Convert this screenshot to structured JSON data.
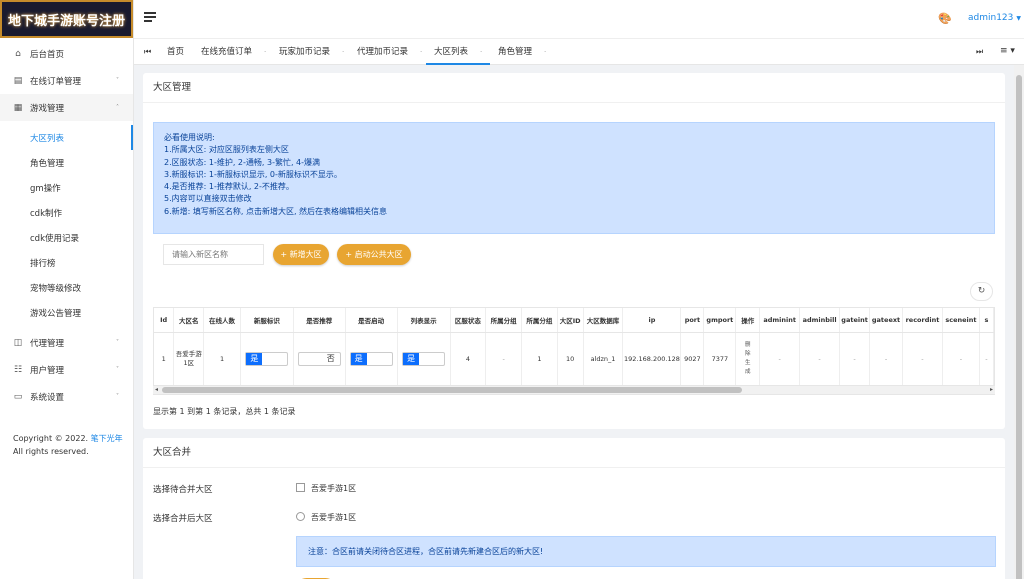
{
  "logo_text": "地下城手游账号注册",
  "sidebar": {
    "items": [
      {
        "label": "后台首页",
        "icon": "dashboard-icon",
        "glyph": "⌂"
      },
      {
        "label": "在线订单管理",
        "icon": "orders-icon",
        "glyph": "▤",
        "chevron": "˅"
      },
      {
        "label": "游戏管理",
        "icon": "game-icon",
        "glyph": "▦",
        "chevron": "˄"
      }
    ],
    "submenu": [
      {
        "label": "大区列表"
      },
      {
        "label": "角色管理"
      },
      {
        "label": "gm操作"
      },
      {
        "label": "cdk制作"
      },
      {
        "label": "cdk使用记录"
      },
      {
        "label": "排行榜"
      },
      {
        "label": "宠物等级修改"
      },
      {
        "label": "游戏公告管理"
      }
    ],
    "items_after": [
      {
        "label": "代理管理",
        "icon": "agent-icon",
        "glyph": "◫",
        "chevron": "˅"
      },
      {
        "label": "用户管理",
        "icon": "users-icon",
        "glyph": "☷",
        "chevron": "˅"
      },
      {
        "label": "系统设置",
        "icon": "settings-icon",
        "glyph": "▭",
        "chevron": "˅"
      }
    ],
    "copyright_prefix": "Copyright © 2022.",
    "copyright_link": "笔下光年",
    "copyright_suffix": "All rights reserved."
  },
  "header": {
    "palette_glyph": "🎨",
    "user": "admin123",
    "user_caret": "▼"
  },
  "tabs": {
    "nav_left": "⏮",
    "nav_right": "⏭",
    "menu": "≡ ▾",
    "close": "·",
    "items": [
      {
        "label": "首页"
      },
      {
        "label": "在线充值订单"
      },
      {
        "label": "玩家加币记录"
      },
      {
        "label": "代理加币记录"
      },
      {
        "label": "大区列表"
      },
      {
        "label": "角色管理"
      }
    ]
  },
  "region_card": {
    "title": "大区管理",
    "notice_lines": [
      "必看使用说明:",
      "1.所属大区: 对应区服列表左侧大区",
      "2.区服状态: 1-维护, 2-通畅, 3-繁忙, 4-爆满",
      "3.新服标识: 1-新服标识显示, 0-新服标识不显示。",
      "4.是否推荐: 1-推荐默认, 2-不推荐。",
      "5.内容可以直接双击修改",
      "6.新增: 填写新区名称, 点击新增大区, 然后在表格编辑相关信息"
    ],
    "input_placeholder": "请输入新区名称",
    "add_button": "+ 新增大区",
    "public_button": "+ 启动公共大区",
    "refresh_glyph": "↻",
    "columns": [
      "Id",
      "大区名",
      "在线人数",
      "新服标识",
      "是否推荐",
      "是否启动",
      "列表显示",
      "区服状态",
      "所属分组",
      "所属分组",
      "大区ID",
      "大区数据库",
      "ip",
      "port",
      "gmport",
      "操作",
      "adminint",
      "adminbill",
      "gateint",
      "gateext",
      "recordint",
      "sceneint",
      "s"
    ],
    "row": {
      "id": "1",
      "name": "吾爱手游1区",
      "online": "1",
      "new_flag": "是",
      "recommend": "否",
      "enabled": "是",
      "list_show": "是",
      "status": "4",
      "group1": "-",
      "group2": "1",
      "region_id": "10",
      "database": "aldzn_1",
      "ip": "192.168.200.128",
      "port": "9027",
      "gmport": "7377",
      "op1": "删除",
      "op2": "生成",
      "dash": "-"
    },
    "scroll_left": "◂",
    "scroll_right": "▸",
    "pager": "显示第 1 到第 1 条记录，总共 1 条记录"
  },
  "merge_card": {
    "title": "大区合并",
    "label_source": "选择待合并大区",
    "label_target": "选择合并后大区",
    "option": "吾爱手游1区",
    "notice": "注意：合区前请关闭待合区进程，合区前请先新建合区后的新大区!"
  }
}
